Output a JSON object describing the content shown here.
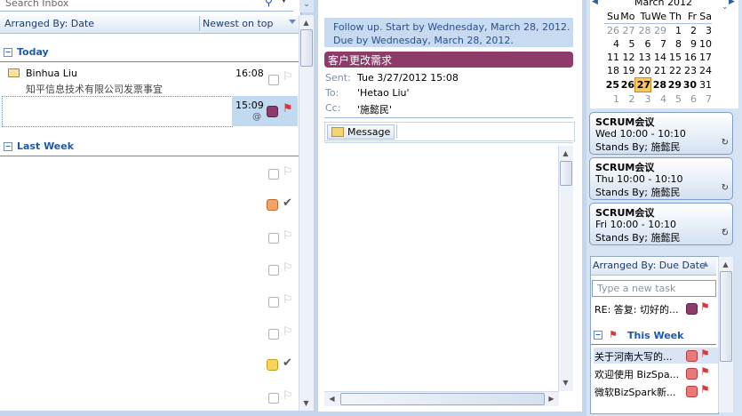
{
  "inbox": {
    "search_placeholder": "Search Inbox",
    "arranged_by": "Arranged By: Date",
    "sort_order": "Newest on top",
    "groups": [
      {
        "label": "Today"
      },
      {
        "label": "Last Week"
      }
    ],
    "messages": [
      {
        "sender": "Binhua Liu",
        "subject": "知平信息技术有限公司发票事宜",
        "time": "16:08"
      },
      {
        "sender": "",
        "subject": "",
        "time": "15:09",
        "selected": true
      }
    ]
  },
  "reading": {
    "followup_line1": "Follow up.  Start by Wednesday, March 28, 2012.",
    "followup_line2": "Due by Wednesday, March 28, 2012.",
    "subject": "客户更改需求",
    "sent_label": "Sent:",
    "sent_value": "Tue 3/27/2012 15:08",
    "to_label": "To:",
    "to_value": "'Hetao Liu'",
    "cc_label": "Cc:",
    "cc_value": "'施懿民'",
    "message_tab": "Message"
  },
  "calendar": {
    "month": "March 2012",
    "day_headers": [
      "Su",
      "Mo",
      "Tu",
      "We",
      "Th",
      "Fr",
      "Sa"
    ],
    "weeks": [
      [
        "26",
        "27",
        "28",
        "29",
        "1",
        "2",
        "3"
      ],
      [
        "4",
        "5",
        "6",
        "7",
        "8",
        "9",
        "10"
      ],
      [
        "11",
        "12",
        "13",
        "14",
        "15",
        "16",
        "17"
      ],
      [
        "18",
        "19",
        "20",
        "21",
        "22",
        "23",
        "24"
      ],
      [
        "25",
        "26",
        "27",
        "28",
        "29",
        "30",
        "31"
      ],
      [
        "1",
        "2",
        "3",
        "4",
        "5",
        "6",
        "7"
      ]
    ],
    "today": "27"
  },
  "appointments": [
    {
      "title": "SCRUM会议",
      "when": "Wed 10:00 - 10:10",
      "stands": "Stands By; 施懿民"
    },
    {
      "title": "SCRUM会议",
      "when": "Thu 10:00 - 10:10",
      "stands": "Stands By; 施懿民"
    },
    {
      "title": "SCRUM会议",
      "when": "Fri 10:00 - 10:10",
      "stands": "Stands By; 施懿民"
    }
  ],
  "todo": {
    "arranged_by": "Arranged By: Due Date",
    "new_task_placeholder": "Type a new task",
    "first_task": "RE: 答复: 切好的...",
    "group_label": "This Week",
    "tasks": [
      "关于河南大写的...",
      "欢迎使用 BizSpa...",
      "微软BizSpark新..."
    ]
  },
  "colors": {
    "accent": "#2058a8",
    "subject_bar": "#8c3b6a",
    "followup_bg": "#c7daf0",
    "category_purple": "#8c3b6a",
    "category_orange": "#f3a46b",
    "category_yellow": "#f7d35c",
    "category_red": "#e87979"
  }
}
